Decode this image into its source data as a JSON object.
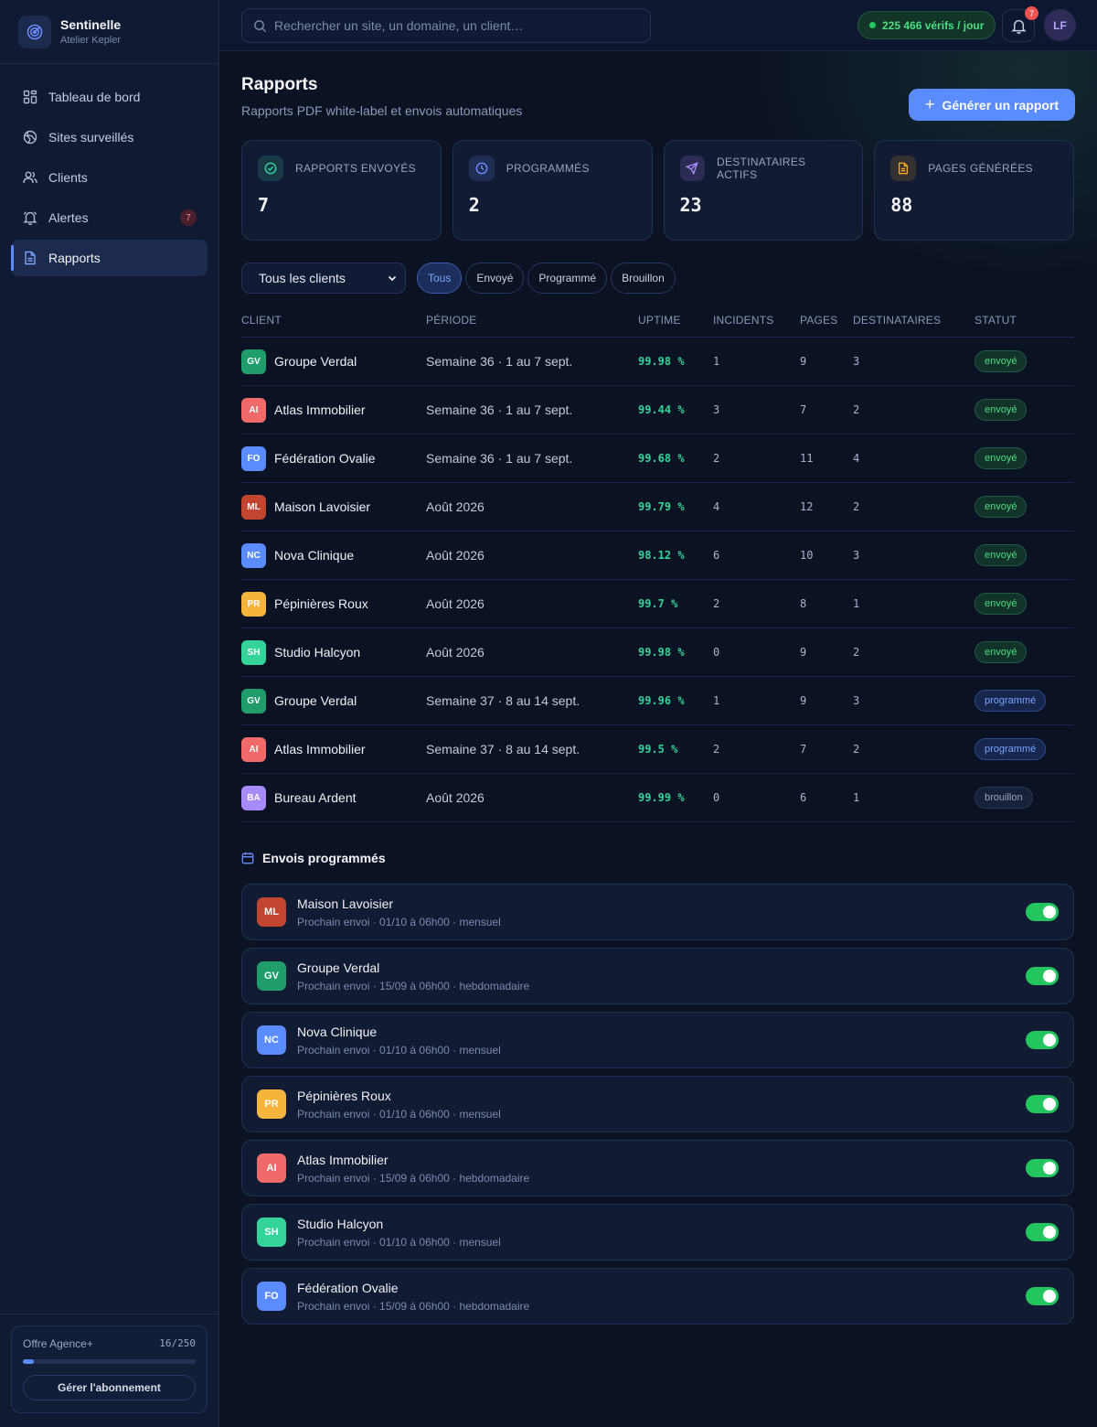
{
  "brand": {
    "name": "Sentinelle",
    "workspace": "Atelier Kepler"
  },
  "sidebar": {
    "items": [
      {
        "label": "Tableau de bord",
        "icon": "grid-icon"
      },
      {
        "label": "Sites surveillés",
        "icon": "globe-icon"
      },
      {
        "label": "Clients",
        "icon": "users-icon"
      },
      {
        "label": "Alertes",
        "icon": "bell-icon",
        "badge": "7"
      },
      {
        "label": "Rapports",
        "icon": "file-icon",
        "active": true
      }
    ],
    "plan": {
      "name": "Offre Agence+",
      "usage": "16/250",
      "usage_fraction": 0.064,
      "button": "Gérer l'abonnement"
    }
  },
  "topbar": {
    "search_placeholder": "Rechercher un site, un domaine, un client…",
    "checks": "225 466 vérifs / jour",
    "notifications": "7",
    "user_initials": "LF"
  },
  "page": {
    "title": "Rapports",
    "subtitle": "Rapports PDF white-label et envois automatiques",
    "generate_button": "Générer un rapport"
  },
  "stats": [
    {
      "label": "RAPPORTS ENVOYÉS",
      "value": "7",
      "icon": "check-circle-icon",
      "color": "#34d399"
    },
    {
      "label": "PROGRAMMÉS",
      "value": "2",
      "icon": "clock-icon",
      "color": "#6b8cff"
    },
    {
      "label": "DESTINATAIRES ACTIFS",
      "value": "23",
      "icon": "send-icon",
      "color": "#a78bfa"
    },
    {
      "label": "PAGES GÉNÉRÉES",
      "value": "88",
      "icon": "document-icon",
      "color": "#f5a524"
    }
  ],
  "filters": {
    "client_select": "Tous les clients",
    "chips": [
      "Tous",
      "Envoyé",
      "Programmé",
      "Brouillon"
    ],
    "active_chip": "Tous"
  },
  "table": {
    "headers": [
      "CLIENT",
      "PÉRIODE",
      "UPTIME",
      "INCIDENTS",
      "PAGES",
      "DESTINATAIRES",
      "STATUT"
    ],
    "rows": [
      {
        "initials": "GV",
        "color": "#1f9d6b",
        "client": "Groupe Verdal",
        "period": "Semaine 36 · 1 au 7 sept.",
        "uptime": "99.98 %",
        "incidents": "1",
        "pages": "9",
        "recipients": "3",
        "status": "envoyé",
        "status_kind": "envoye"
      },
      {
        "initials": "AI",
        "color": "#f06a6a",
        "client": "Atlas Immobilier",
        "period": "Semaine 36 · 1 au 7 sept.",
        "uptime": "99.44 %",
        "incidents": "3",
        "pages": "7",
        "recipients": "2",
        "status": "envoyé",
        "status_kind": "envoye"
      },
      {
        "initials": "FO",
        "color": "#5b8cff",
        "client": "Fédération Ovalie",
        "period": "Semaine 36 · 1 au 7 sept.",
        "uptime": "99.68 %",
        "incidents": "2",
        "pages": "11",
        "recipients": "4",
        "status": "envoyé",
        "status_kind": "envoye"
      },
      {
        "initials": "ML",
        "color": "#c2452f",
        "client": "Maison Lavoisier",
        "period": "Août 2026",
        "uptime": "99.79 %",
        "incidents": "4",
        "pages": "12",
        "recipients": "2",
        "status": "envoyé",
        "status_kind": "envoye"
      },
      {
        "initials": "NC",
        "color": "#5b8cff",
        "client": "Nova Clinique",
        "period": "Août 2026",
        "uptime": "98.12 %",
        "incidents": "6",
        "pages": "10",
        "recipients": "3",
        "status": "envoyé",
        "status_kind": "envoye"
      },
      {
        "initials": "PR",
        "color": "#f5b43c",
        "client": "Pépinières Roux",
        "period": "Août 2026",
        "uptime": "99.7 %",
        "incidents": "2",
        "pages": "8",
        "recipients": "1",
        "status": "envoyé",
        "status_kind": "envoye"
      },
      {
        "initials": "SH",
        "color": "#34d399",
        "client": "Studio Halcyon",
        "period": "Août 2026",
        "uptime": "99.98 %",
        "incidents": "0",
        "pages": "9",
        "recipients": "2",
        "status": "envoyé",
        "status_kind": "envoye"
      },
      {
        "initials": "GV",
        "color": "#1f9d6b",
        "client": "Groupe Verdal",
        "period": "Semaine 37 · 8 au 14 sept.",
        "uptime": "99.96 %",
        "incidents": "1",
        "pages": "9",
        "recipients": "3",
        "status": "programmé",
        "status_kind": "programme"
      },
      {
        "initials": "AI",
        "color": "#f06a6a",
        "client": "Atlas Immobilier",
        "period": "Semaine 37 · 8 au 14 sept.",
        "uptime": "99.5 %",
        "incidents": "2",
        "pages": "7",
        "recipients": "2",
        "status": "programmé",
        "status_kind": "programme"
      },
      {
        "initials": "BA",
        "color": "#a78bfa",
        "client": "Bureau Ardent",
        "period": "Août 2026",
        "uptime": "99.99 %",
        "incidents": "0",
        "pages": "6",
        "recipients": "1",
        "status": "brouillon",
        "status_kind": "brouillon"
      }
    ]
  },
  "scheduled": {
    "title": "Envois programmés",
    "items": [
      {
        "initials": "ML",
        "color": "#c2452f",
        "client": "Maison Lavoisier",
        "next": "Prochain envoi · 01/10 à 06h00 · mensuel",
        "enabled": true
      },
      {
        "initials": "GV",
        "color": "#1f9d6b",
        "client": "Groupe Verdal",
        "next": "Prochain envoi · 15/09 à 06h00 · hebdomadaire",
        "enabled": true
      },
      {
        "initials": "NC",
        "color": "#5b8cff",
        "client": "Nova Clinique",
        "next": "Prochain envoi · 01/10 à 06h00 · mensuel",
        "enabled": true
      },
      {
        "initials": "PR",
        "color": "#f5b43c",
        "client": "Pépinières Roux",
        "next": "Prochain envoi · 01/10 à 06h00 · mensuel",
        "enabled": true
      },
      {
        "initials": "AI",
        "color": "#f06a6a",
        "client": "Atlas Immobilier",
        "next": "Prochain envoi · 15/09 à 06h00 · hebdomadaire",
        "enabled": true
      },
      {
        "initials": "SH",
        "color": "#34d399",
        "client": "Studio Halcyon",
        "next": "Prochain envoi · 01/10 à 06h00 · mensuel",
        "enabled": true
      },
      {
        "initials": "FO",
        "color": "#5b8cff",
        "client": "Fédération Ovalie",
        "next": "Prochain envoi · 15/09 à 06h00 · hebdomadaire",
        "enabled": true
      }
    ]
  }
}
